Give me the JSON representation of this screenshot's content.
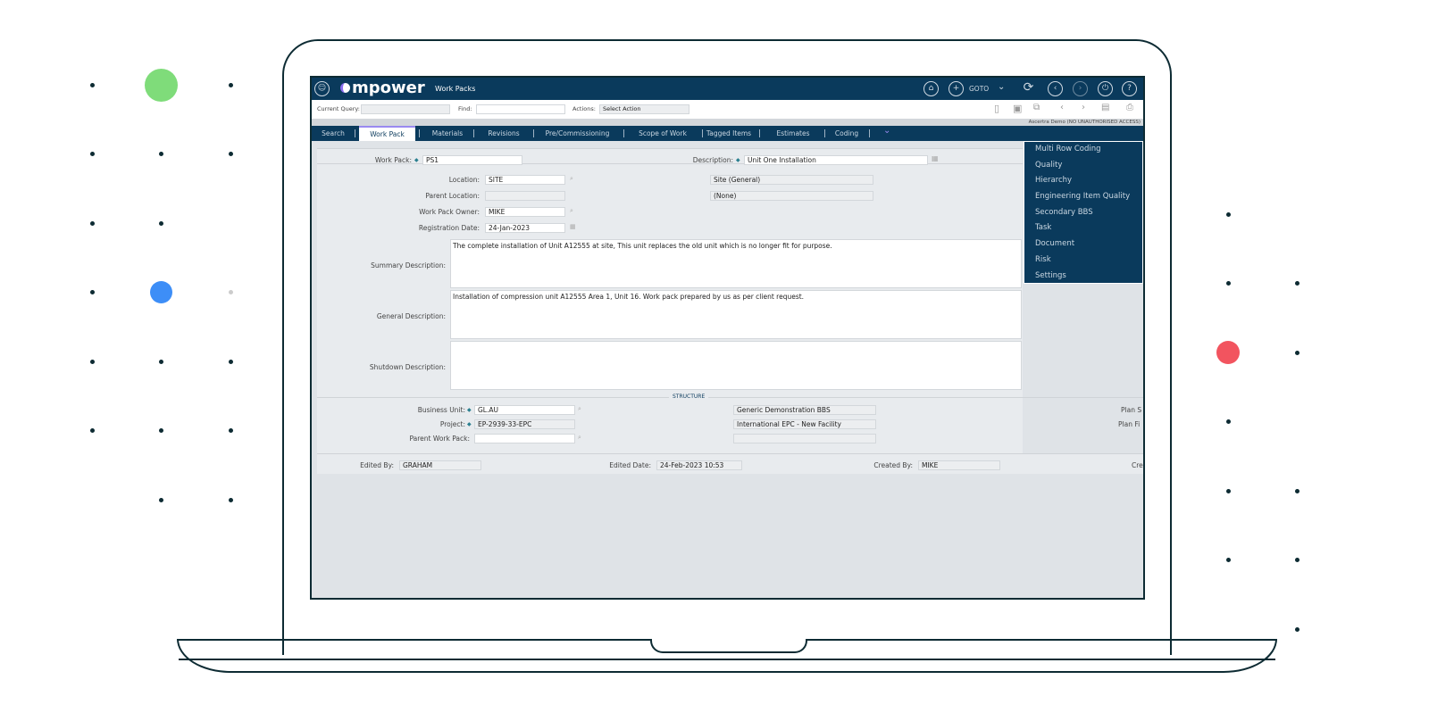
{
  "app": {
    "logo": "mpower",
    "module": "Work Packs",
    "goto_label": "GOTO",
    "env_notice": "Ascertra Demo (NO UNAUTHORISED ACCESS)"
  },
  "toolbar": {
    "current_query_label": "Current Query:",
    "current_query_value": "",
    "find_label": "Find:",
    "find_value": "",
    "actions_label": "Actions:",
    "actions_value": "Select Action"
  },
  "tabs": [
    {
      "label": "Search"
    },
    {
      "label": "Work Pack",
      "active": true
    },
    {
      "label": "Materials"
    },
    {
      "label": "Revisions"
    },
    {
      "label": "Pre/Commissioning"
    },
    {
      "label": "Scope of Work"
    },
    {
      "label": "Tagged Items"
    },
    {
      "label": "Estimates"
    },
    {
      "label": "Coding"
    }
  ],
  "more_menu": [
    "Multi Row Coding",
    "Quality",
    "Hierarchy",
    "Engineering Item Quality",
    "Secondary BBS",
    "Task",
    "Document",
    "Risk",
    "Settings"
  ],
  "form": {
    "work_pack": {
      "label": "Work Pack:",
      "value": "PS1"
    },
    "description": {
      "label": "Description:",
      "value": "Unit One Installation"
    },
    "location": {
      "label": "Location:",
      "value": "SITE",
      "desc": "Site (General)"
    },
    "parent_location": {
      "label": "Parent Location:",
      "value": "",
      "desc": "(None)"
    },
    "owner": {
      "label": "Work Pack Owner:",
      "value": "MIKE"
    },
    "registration_date": {
      "label": "Registration Date:",
      "value": "24-Jan-2023"
    },
    "summary": {
      "label": "Summary Description:",
      "value": "The complete installation of Unit A12555 at site, This unit replaces the old unit which is no longer fit for purpose."
    },
    "general": {
      "label": "General Description:",
      "value": "Installation of compression unit A12555 Area 1, Unit 16. Work pack prepared by us as per client request."
    },
    "shutdown": {
      "label": "Shutdown Description:",
      "value": ""
    },
    "structure_heading": "STRUCTURE",
    "business_unit": {
      "label": "Business Unit:",
      "value": "GL.AU",
      "desc": "Generic Demonstration BBS"
    },
    "project": {
      "label": "Project:",
      "value": "EP-2939-33-EPC",
      "desc": "International EPC - New Facility"
    },
    "parent_work_pack": {
      "label": "Parent Work Pack:",
      "value": "",
      "desc": ""
    },
    "plan_start_label": "Plan S",
    "plan_finish_label": "Plan Fi",
    "edited_by": {
      "label": "Edited By:",
      "value": "GRAHAM"
    },
    "edited_date": {
      "label": "Edited Date:",
      "value": "24-Feb-2023 10:53"
    },
    "created_by": {
      "label": "Created By:",
      "value": "MIKE"
    },
    "created_date_label": "Cre"
  },
  "colors": {
    "brand_dark": "#0a3a5c",
    "accent_purple": "#8a6cf0",
    "dot_green": "#7fdc7a",
    "dot_blue": "#3d8ef7",
    "dot_red": "#f2545f"
  }
}
